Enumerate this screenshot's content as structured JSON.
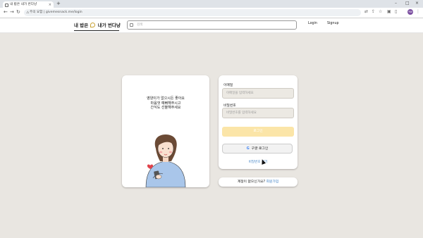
{
  "browser": {
    "tab_title": "내 밥은 내가 번다냥",
    "new_tab": "+",
    "url_warning": "주의 요함",
    "url": "givemesnack.me/login",
    "profile_initials": "YW"
  },
  "header": {
    "logo_text_1": "내 밥은",
    "logo_text_2": "내가 번다냥",
    "search_placeholder": "검색",
    "login": "Login",
    "signup": "Signup"
  },
  "illustration": {
    "message_line1": "영양이가 없으시든 좋아요",
    "message_line2": "마음껏 예뻐해주시고",
    "message_line3": "간식도 선물해주세요"
  },
  "form": {
    "email_label": "이메일",
    "email_placeholder": "이메일을 입력하세요",
    "password_label": "비밀번호",
    "password_placeholder": "비밀번호를 입력하세요",
    "login_button": "로그인",
    "google_icon": "G",
    "google_button": "구글 로그인",
    "forgot_password": "비밀번호 찾기"
  },
  "signup": {
    "prompt": "계정이 없으신가요?",
    "link": "회원가입"
  },
  "colors": {
    "accent": "#fbe5a8",
    "link": "#3d7fc4",
    "background": "#e9e6e1"
  }
}
